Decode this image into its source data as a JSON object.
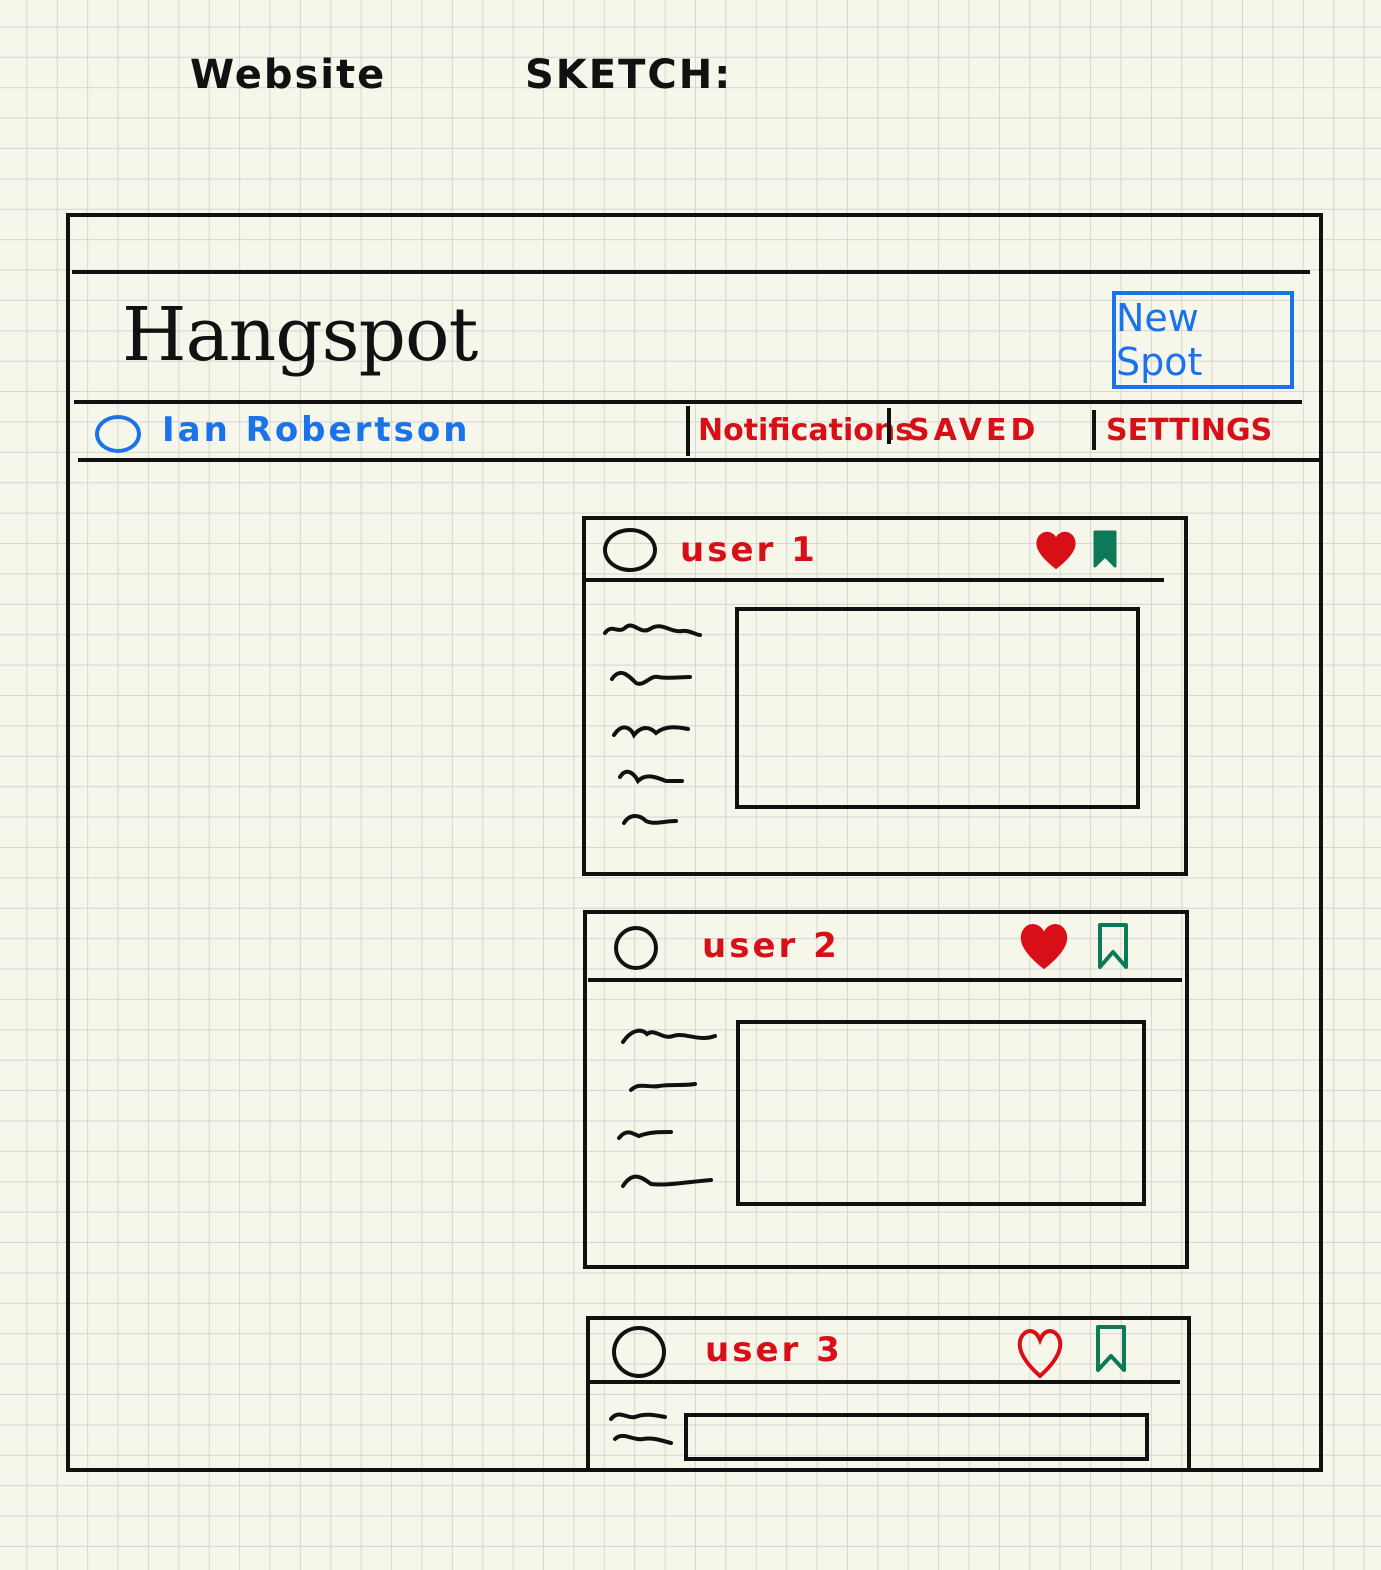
{
  "title": {
    "left": "Website",
    "right": "SKETCH:"
  },
  "app": {
    "brand": "Hangspot",
    "new_spot_label": "New Spot",
    "user_name": "Ian Robertson",
    "nav": [
      "Notifications",
      "SAVED",
      "SETTINGS"
    ]
  },
  "posts": [
    {
      "user": "user 1",
      "liked": true,
      "saved": true
    },
    {
      "user": "user 2",
      "liked": true,
      "saved": false
    },
    {
      "user": "user 3",
      "liked": false,
      "saved": false
    }
  ],
  "colors": {
    "paper": "#f7f6ea",
    "ink": "#111111",
    "blue": "#1a73e8",
    "red": "#d90f18",
    "green": "#0c7a58"
  },
  "icons": [
    "avatar-circle-icon",
    "heart-icon",
    "bookmark-icon",
    "text-scribble-icon"
  ]
}
